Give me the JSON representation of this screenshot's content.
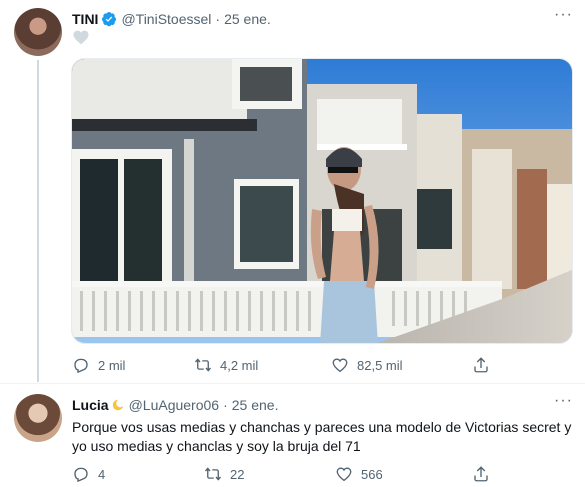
{
  "tweet": {
    "author_name": "TINI",
    "author_handle": "@TiniStoessel",
    "separator": "·",
    "date": "25 ene.",
    "more_label": "···",
    "actions": {
      "replies": "2 mil",
      "retweets": "4,2 mil",
      "likes": "82,5 mil"
    }
  },
  "reply": {
    "author_name": "Lucia",
    "author_handle": "@LuAguero06",
    "separator": "·",
    "date": "25 ene.",
    "text": "Porque vos usas medias y chanchas y pareces una modelo de Victorias secret y yo uso medias y chanclas y soy la bruja del 71",
    "actions": {
      "replies": "4",
      "retweets": "22",
      "likes": "566"
    }
  },
  "icons": [
    "verified-badge-icon",
    "heart-icon",
    "reply-icon",
    "retweet-icon",
    "like-icon",
    "share-icon",
    "moon-emoji-icon"
  ],
  "colors": {
    "text": "#0f1419",
    "secondary": "#536471",
    "verified": "#1d9bf0",
    "line": "#cfd9de"
  }
}
